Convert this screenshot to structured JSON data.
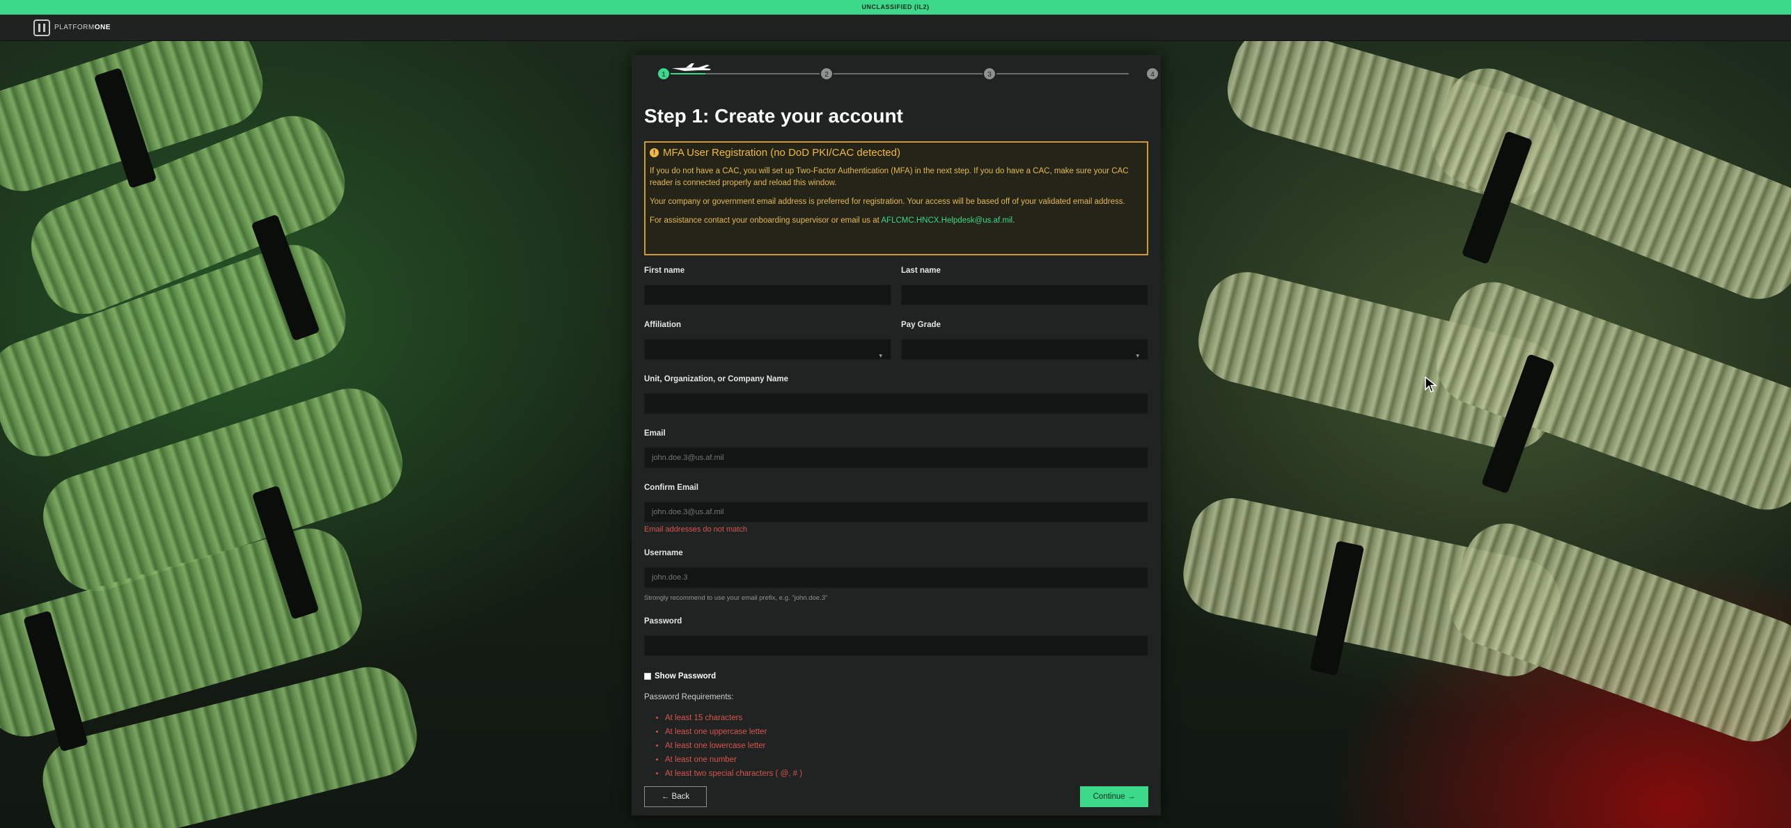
{
  "banner": {
    "text": "UNCLASSIFIED (IL2)"
  },
  "app": {
    "logo_text_light": "PLATFORM",
    "logo_text_bold": "ONE"
  },
  "stepper": {
    "steps": [
      "1",
      "2",
      "3",
      "4"
    ],
    "active_step": 1
  },
  "page": {
    "title": "Step 1: Create your account"
  },
  "alert": {
    "heading": "MFA User Registration (no DoD PKI/CAC detected)",
    "p1": "If you do not have a CAC, you will set up Two-Factor Authentication (MFA) in the next step. If you do have a CAC, make sure your CAC reader is connected properly and reload this window.",
    "p2": "Your company or government email address is preferred for registration. Your access will be based off of your validated email address.",
    "p3_prefix": "For assistance contact your onboarding supervisor or email us at ",
    "p3_email": "AFLCMC.HNCX.Helpdesk@us.af.mil",
    "p3_suffix": "."
  },
  "form": {
    "first_name": {
      "label": "First name",
      "value": ""
    },
    "last_name": {
      "label": "Last name",
      "value": ""
    },
    "affiliation": {
      "label": "Affiliation",
      "value": ""
    },
    "pay_grade": {
      "label": "Pay Grade",
      "value": ""
    },
    "unit": {
      "label": "Unit, Organization, or Company Name",
      "value": ""
    },
    "email": {
      "label": "Email",
      "placeholder": "john.doe.3@us.af.mil"
    },
    "confirm_email": {
      "label": "Confirm Email",
      "placeholder": "john.doe.3@us.af.mil",
      "error": "Email addresses do not match"
    },
    "username": {
      "label": "Username",
      "placeholder": "john.doe.3",
      "hint": "Strongly recommend to use your email prefix, e.g. \"john.doe.3\""
    },
    "password": {
      "label": "Password",
      "value": ""
    },
    "show_password": {
      "label": "Show Password"
    },
    "requirements": {
      "title": "Password Requirements:",
      "items": [
        "At least 15 characters",
        "At least one uppercase letter",
        "At least one lowercase letter",
        "At least one number",
        "At least two special characters ( @, # )"
      ]
    }
  },
  "buttons": {
    "back": "← Back",
    "continue": "Continue →"
  },
  "colors": {
    "accent": "#3cd98a",
    "warning": "#f0b840",
    "error": "#d9534f"
  },
  "icons": {
    "warning": "exclamation-circle-icon",
    "plane": "airplane-icon",
    "cursor": "mouse-pointer-icon"
  }
}
